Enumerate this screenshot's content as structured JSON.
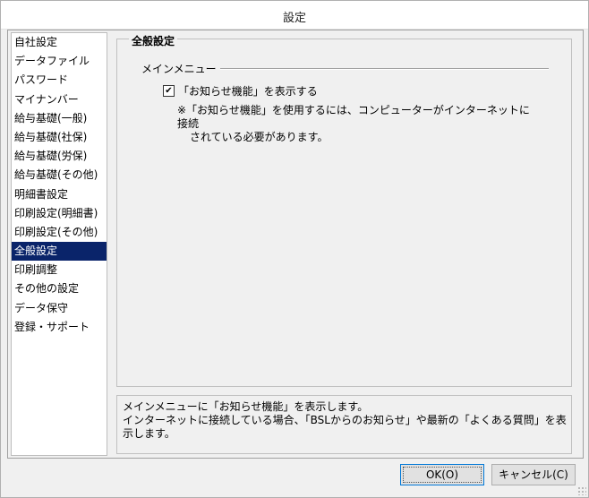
{
  "window": {
    "title": "設定"
  },
  "sidebar": {
    "items": [
      {
        "label": "自社設定",
        "selected": false
      },
      {
        "label": "データファイル",
        "selected": false
      },
      {
        "label": "パスワード",
        "selected": false
      },
      {
        "label": "マイナンバー",
        "selected": false
      },
      {
        "label": "給与基礎(一般)",
        "selected": false
      },
      {
        "label": "給与基礎(社保)",
        "selected": false
      },
      {
        "label": "給与基礎(労保)",
        "selected": false
      },
      {
        "label": "給与基礎(その他)",
        "selected": false
      },
      {
        "label": "明細書設定",
        "selected": false
      },
      {
        "label": "印刷設定(明細書)",
        "selected": false
      },
      {
        "label": "印刷設定(その他)",
        "selected": false
      },
      {
        "label": "全般設定",
        "selected": true
      },
      {
        "label": "印刷調整",
        "selected": false
      },
      {
        "label": "その他の設定",
        "selected": false
      },
      {
        "label": "データ保守",
        "selected": false
      },
      {
        "label": "登録・サポート",
        "selected": false
      }
    ]
  },
  "panel": {
    "title": "全般設定",
    "group_label": "メインメニュー",
    "checkbox": {
      "label": "「お知らせ機能」を表示する",
      "checked": true
    },
    "note_line1": "※「お知らせ機能」を使用するには、コンピューターがインターネットに接続",
    "note_line2": "されている必要があります。"
  },
  "description": {
    "line1": "メインメニューに「お知らせ機能」を表示します。",
    "line2": "インターネットに接続している場合、「BSLからのお知らせ」や最新の「よくある質問」を表示します。"
  },
  "buttons": {
    "ok": "OK(O)",
    "cancel": "キャンセル(C)"
  }
}
